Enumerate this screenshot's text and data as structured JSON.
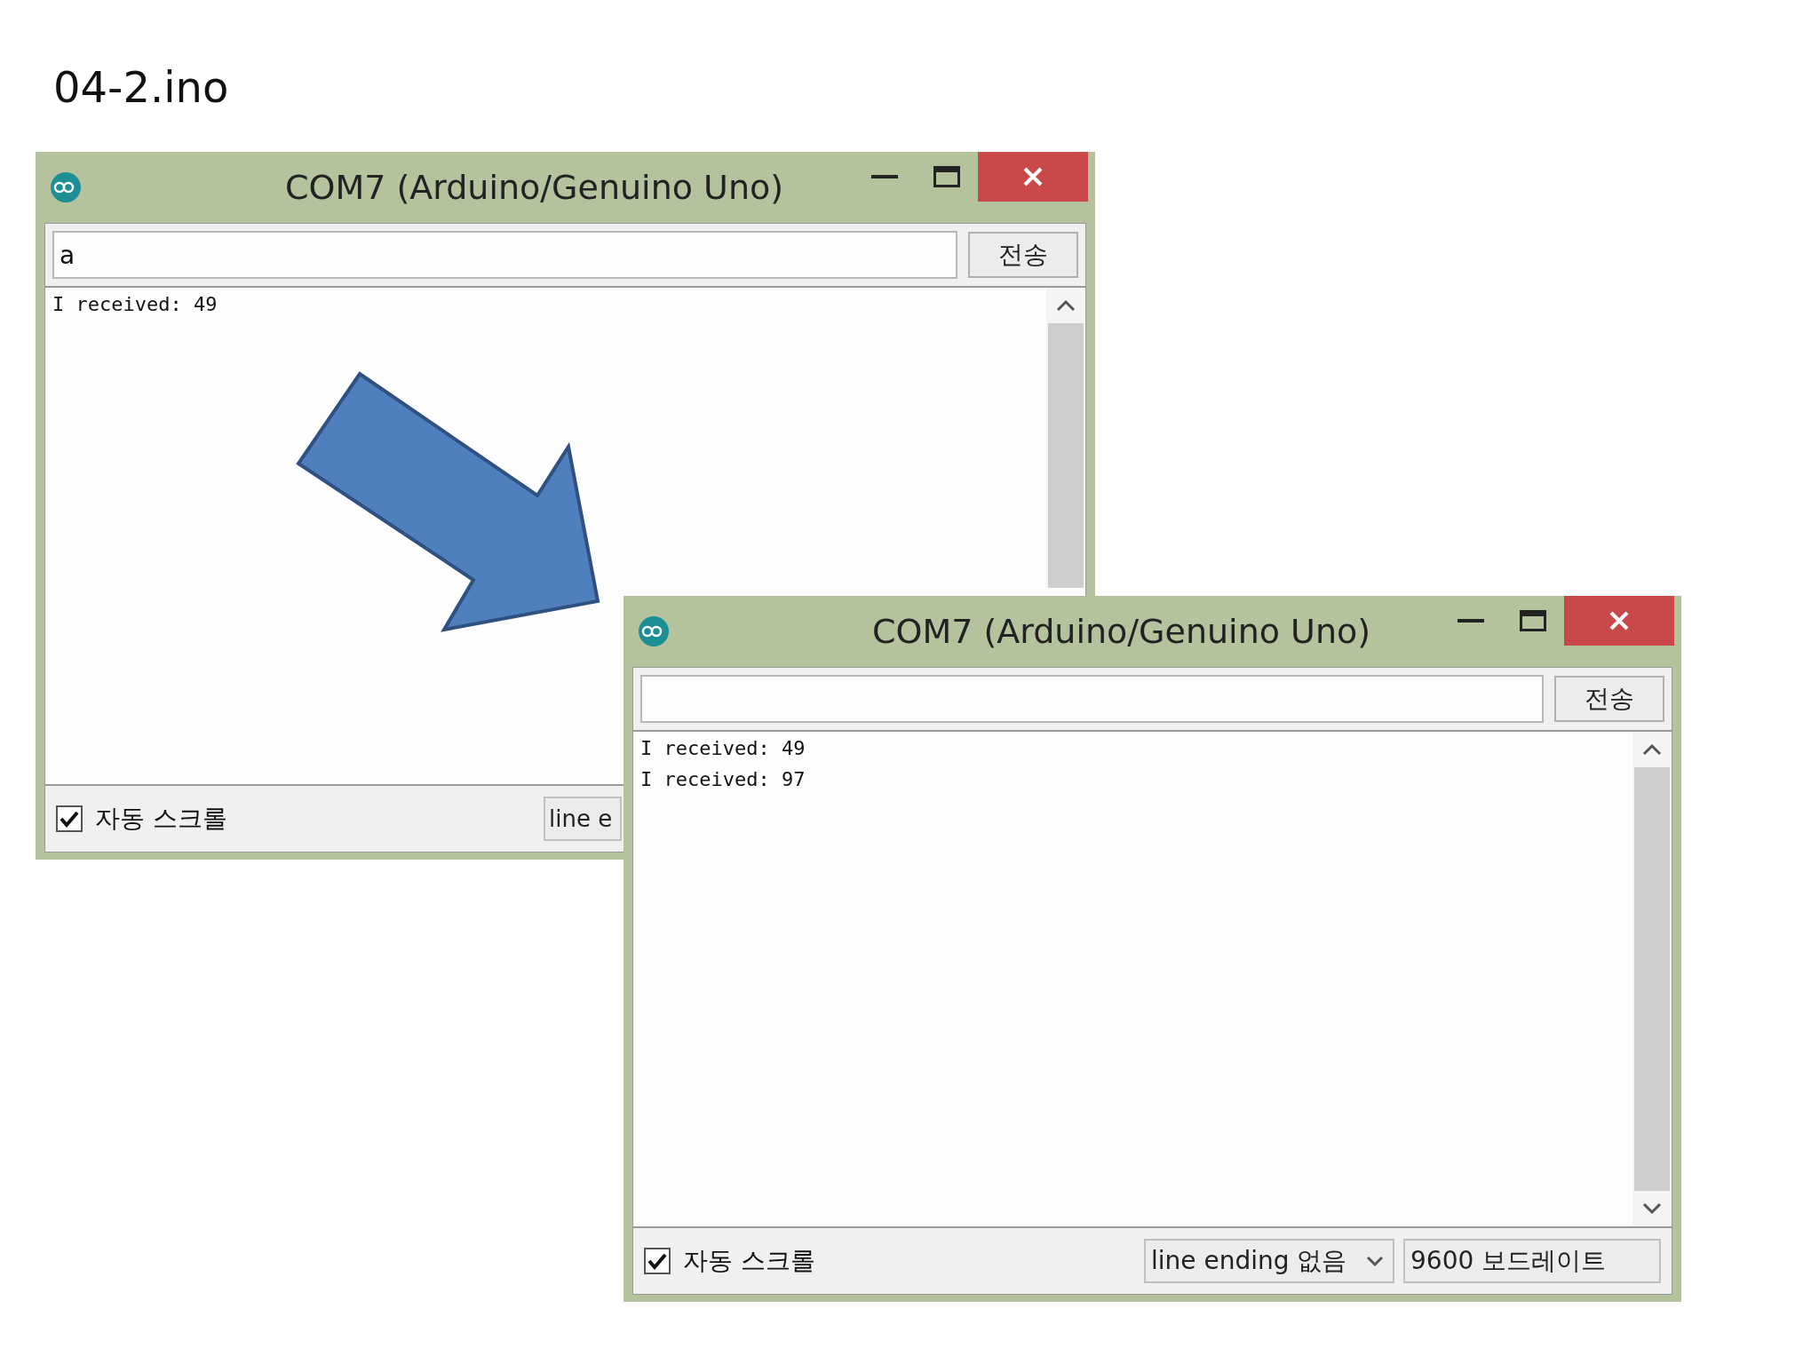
{
  "slide_title": "04-2.ino",
  "windows": [
    {
      "title": "COM7 (Arduino/Genuino Uno)",
      "input": {
        "value": "a"
      },
      "send_button": "전송",
      "log": [
        "I received: 49"
      ],
      "autoscroll": {
        "label": "자동 스크롤",
        "checked": true
      },
      "line_ending": "line e"
    },
    {
      "title": "COM7 (Arduino/Genuino Uno)",
      "send_button": "전송",
      "log": [
        "I received: 49",
        "I received: 97"
      ],
      "autoscroll": {
        "label": "자동 스크롤",
        "checked": true
      },
      "line_ending": "line ending 없음",
      "baud_rate": "9600 보드레이트"
    }
  ]
}
